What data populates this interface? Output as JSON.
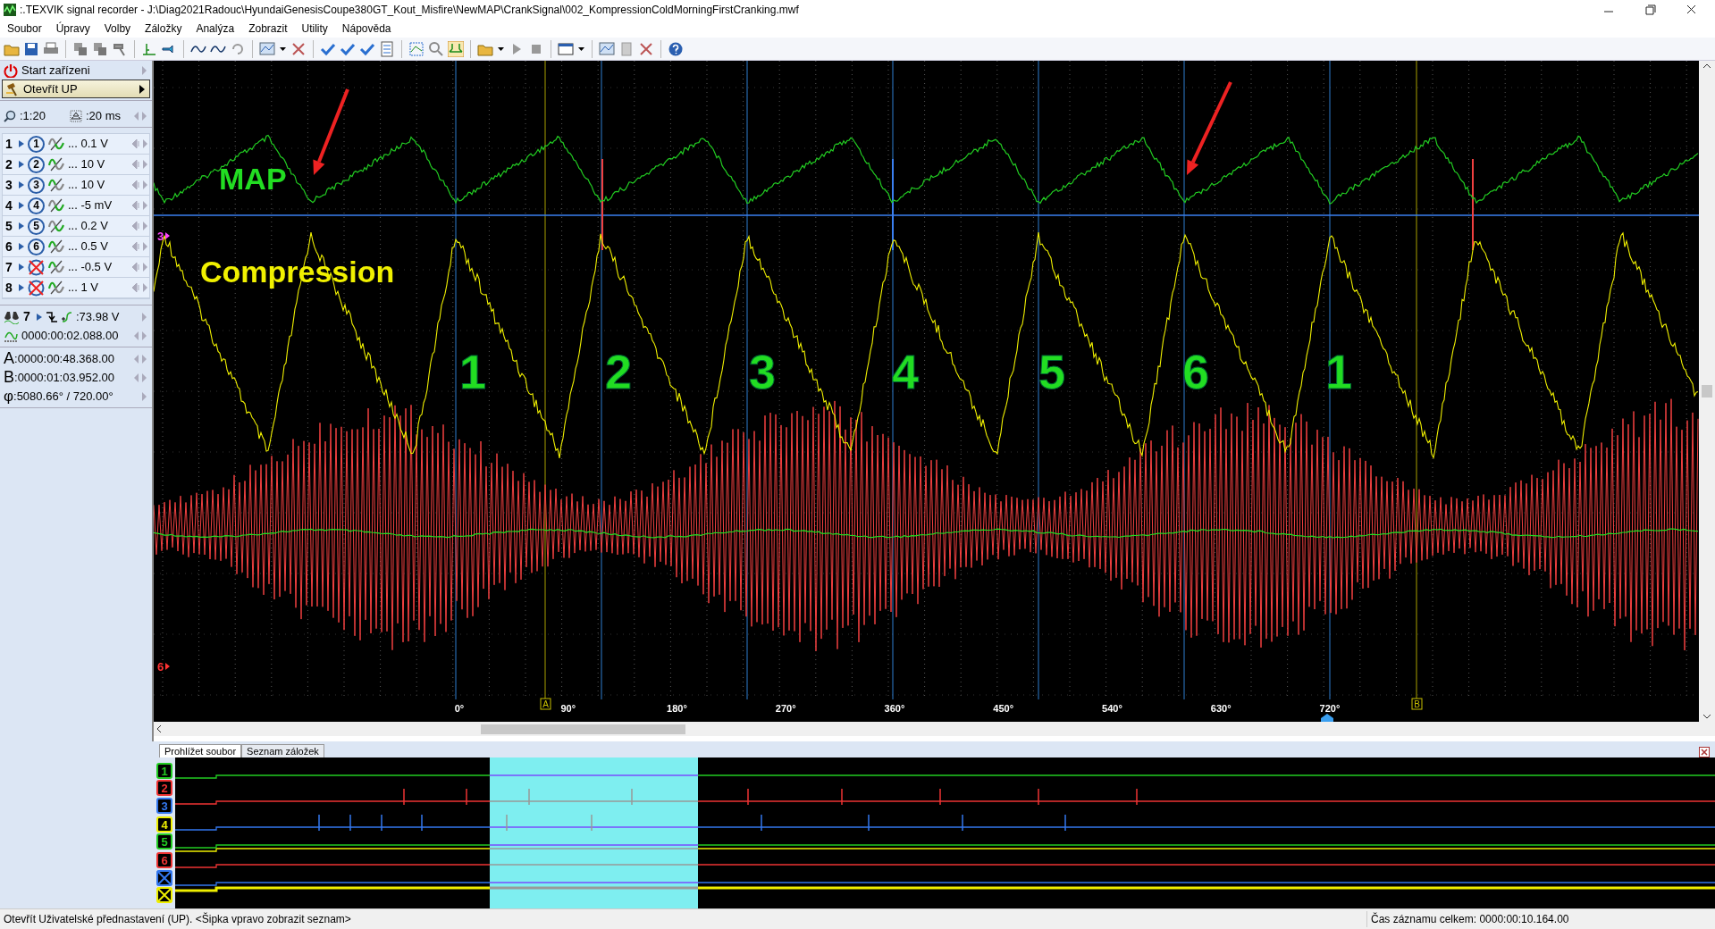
{
  "window": {
    "title": ":.TEXVIK  signal recorder - J:\\Diag2021Radouc\\HyundaiGenesisCoupe380GT_Kout_Misfire\\NewMAP\\CrankSignal\\002_KompressionColdMorningFirstCranking.mwf"
  },
  "menu": [
    "Soubor",
    "Úpravy",
    "Volby",
    "Záložky",
    "Analýza",
    "Zobrazit",
    "Utility",
    "Nápověda"
  ],
  "left_panel": {
    "start_button": "Start zařízeni",
    "open_button": "Otevřít UP",
    "zoom": ":1:20",
    "timebase": ":20 ms",
    "channels": [
      {
        "number": "1",
        "probe": "1",
        "range": "... 0.1 V",
        "wave_top": false,
        "disabled": false
      },
      {
        "number": "2",
        "probe": "2",
        "range": "... 10 V",
        "wave_top": true,
        "disabled": false
      },
      {
        "number": "3",
        "probe": "3",
        "range": "... 10 V",
        "wave_top": true,
        "disabled": false
      },
      {
        "number": "4",
        "probe": "4",
        "range": "... -5 mV",
        "wave_top": false,
        "disabled": false
      },
      {
        "number": "5",
        "probe": "5",
        "range": "... 0.2 V",
        "wave_top": false,
        "disabled": false
      },
      {
        "number": "6",
        "probe": "6",
        "range": "... 0.5 V",
        "wave_top": true,
        "disabled": false
      },
      {
        "number": "7",
        "range": "... -0.5 V",
        "wave_top": true,
        "disabled": true
      },
      {
        "number": "8",
        "range": "... 1 V",
        "wave_top": true,
        "disabled": true
      }
    ],
    "trigger": {
      "channel": "7",
      "level": ":73.98 V"
    },
    "pretrigger": "0000:00:02.088.00",
    "cursor_a": {
      "label": "A",
      "time": ":0000:00:48.368.00"
    },
    "cursor_b": {
      "label": "B",
      "time": ":0000:01:03.952.00"
    },
    "phase": {
      "label": "φ",
      "value": ":5080.66° / 720.00°"
    }
  },
  "scope": {
    "labels": [
      {
        "kind": "map",
        "text": "MAP"
      },
      {
        "kind": "compression",
        "text": "Compression"
      }
    ],
    "cylinder_numbers": [
      "1",
      "2",
      "3",
      "4",
      "5",
      "6",
      "1"
    ],
    "channel_markers": [
      {
        "text": "3",
        "color": "#ff44ff"
      },
      {
        "text": "6",
        "color": "#ff3333"
      }
    ],
    "axis_labels": [
      "0°",
      "90°",
      "180°",
      "270°",
      "360°",
      "450°",
      "540°",
      "630°",
      "720°"
    ],
    "cursors": [
      {
        "label": "A"
      },
      {
        "label": "B"
      }
    ]
  },
  "bottom": {
    "tabs": [
      {
        "label": "Prohlížet soubor",
        "selected": true
      },
      {
        "label": "Seznam záložek",
        "selected": false
      }
    ],
    "channels": [
      {
        "label": "1",
        "color": "#22cc22",
        "disabled": false
      },
      {
        "label": "2",
        "color": "#ee3333",
        "disabled": false
      },
      {
        "label": "3",
        "color": "#3377ee",
        "disabled": false
      },
      {
        "label": "4",
        "color": "#eeee00",
        "disabled": false
      },
      {
        "label": "5",
        "color": "#22cc22",
        "disabled": false
      },
      {
        "label": "6",
        "color": "#ee3333",
        "disabled": false
      },
      {
        "color": "#3377ee",
        "disabled": true
      },
      {
        "color": "#eeee00",
        "disabled": true
      }
    ]
  },
  "status_bar": {
    "hint": "Otevřít Uživatelské přednastavení (UP). <Šipka vpravo zobrazit seznam>",
    "total_time": "Čas záznamu celkem: 0000:00:10.164.00"
  }
}
